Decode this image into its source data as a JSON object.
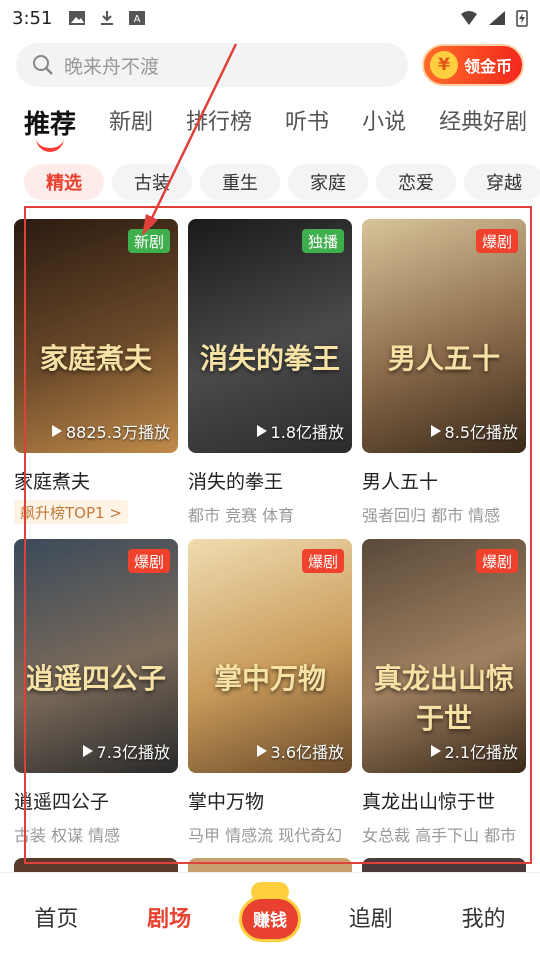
{
  "status_bar": {
    "time": "3:51"
  },
  "search": {
    "placeholder": "晚来舟不渡",
    "coin_button": "领金币",
    "coin_symbol": "¥"
  },
  "tabs": [
    {
      "label": "推荐",
      "active": true
    },
    {
      "label": "新剧"
    },
    {
      "label": "排行榜"
    },
    {
      "label": "听书"
    },
    {
      "label": "小说"
    },
    {
      "label": "经典好剧"
    }
  ],
  "chips": [
    {
      "label": "精选",
      "active": true
    },
    {
      "label": "古装"
    },
    {
      "label": "重生"
    },
    {
      "label": "家庭"
    },
    {
      "label": "恋爱"
    },
    {
      "label": "穿越"
    }
  ],
  "cards": [
    {
      "title": "家庭煮夫",
      "poster_text": "家庭煮夫",
      "badge": "新剧",
      "badge_color": "green",
      "plays": "8825.3万播放",
      "rank": "飙升榜TOP1 >",
      "tags": "",
      "bg": "linear-gradient(160deg,#2a1a10,#6b4a2a 55%,#c08a4a)"
    },
    {
      "title": "消失的拳王",
      "poster_text": "消失的拳王",
      "badge": "独播",
      "badge_color": "green",
      "plays": "1.8亿播放",
      "rank": "",
      "tags": "都市 竞赛 体育",
      "bg": "linear-gradient(160deg,#1a1a1a,#4a4a4a 55%,#2b2b2b)"
    },
    {
      "title": "男人五十",
      "poster_text": "男人五十",
      "badge": "爆剧",
      "badge_color": "red",
      "plays": "8.5亿播放",
      "rank": "",
      "tags": "强者回归 都市 情感",
      "bg": "linear-gradient(160deg,#d8c49a,#8a6a4a 55%,#3a2a1a)"
    },
    {
      "title": "逍遥四公子",
      "poster_text": "逍遥四公子",
      "badge": "爆剧",
      "badge_color": "red",
      "plays": "7.3亿播放",
      "rank": "",
      "tags": "古装 权谋 情感",
      "bg": "linear-gradient(160deg,#3a4a5a,#7a6a5a 55%,#2a2a2a)"
    },
    {
      "title": "掌中万物",
      "poster_text": "掌中万物",
      "badge": "爆剧",
      "badge_color": "red",
      "plays": "3.6亿播放",
      "rank": "",
      "tags": "马甲 情感流 现代奇幻",
      "bg": "linear-gradient(160deg,#f0dcb0,#c89a5a 55%,#6a4a2a)"
    },
    {
      "title": "真龙出山惊于世",
      "poster_text": "真龙出山惊于世",
      "badge": "爆剧",
      "badge_color": "red",
      "plays": "2.1亿播放",
      "rank": "",
      "tags": "女总裁 高手下山 都市",
      "bg": "linear-gradient(160deg,#5a4a3a,#a08060 55%,#3a2a1a)"
    }
  ],
  "bottom_nav": [
    {
      "label": "首页"
    },
    {
      "label": "剧场",
      "active": true
    },
    {
      "label": "赚钱",
      "center": true
    },
    {
      "label": "追剧"
    },
    {
      "label": "我的"
    }
  ]
}
